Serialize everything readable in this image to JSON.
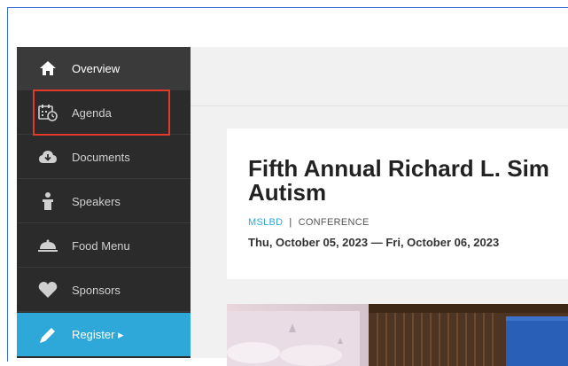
{
  "sidebar": {
    "items": [
      {
        "id": "overview",
        "label": "Overview",
        "icon": "home-icon"
      },
      {
        "id": "agenda",
        "label": "Agenda",
        "icon": "calendar-clock-icon"
      },
      {
        "id": "documents",
        "label": "Documents",
        "icon": "cloud-download-icon"
      },
      {
        "id": "speakers",
        "label": "Speakers",
        "icon": "speaker-podium-icon"
      },
      {
        "id": "food",
        "label": "Food Menu",
        "icon": "food-cloche-icon"
      },
      {
        "id": "sponsors",
        "label": "Sponsors",
        "icon": "heart-icon"
      },
      {
        "id": "register",
        "label": "Register ▸",
        "icon": "pencil-icon"
      }
    ],
    "active": "overview",
    "highlighted": "agenda"
  },
  "event": {
    "title_line1": "Fifth Annual Richard L. Sim",
    "title_line2": "Autism",
    "organizer": "MSLBD",
    "type": "CONFERENCE",
    "dates": "Thu, October 05, 2023 — Fri, October 06, 2023"
  },
  "colors": {
    "sidebar_bg": "#2b2b2b",
    "register_bg": "#2ea8d9",
    "highlight": "#e2392b",
    "accent": "#2ea8d9"
  }
}
